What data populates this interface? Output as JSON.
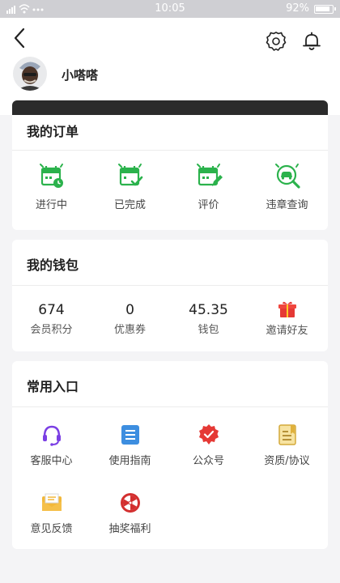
{
  "status_bar": {
    "time": "10:05",
    "battery": "92%",
    "signal_icon": "wifi-signal-icon"
  },
  "header": {
    "username": "小嗒嗒",
    "icons": [
      "back-arrow-icon",
      "gear-icon",
      "bell-icon"
    ]
  },
  "colors": {
    "accent": "#2bb24c",
    "card_bg": "#ffffff",
    "page_bg": "#f4f4f6",
    "dark_bar": "#2b2b2b"
  },
  "orders": {
    "title": "我的订单",
    "items": [
      {
        "label": "进行中",
        "icon": "calendar-clock-icon"
      },
      {
        "label": "已完成",
        "icon": "calendar-check-icon"
      },
      {
        "label": "评价",
        "icon": "calendar-edit-icon"
      },
      {
        "label": "违章查询",
        "icon": "car-search-icon"
      }
    ]
  },
  "wallet": {
    "title": "我的钱包",
    "items": [
      {
        "value": "674",
        "label": "会员积分"
      },
      {
        "value": "0",
        "label": "优惠券"
      },
      {
        "value": "45.35",
        "label": "钱包"
      },
      {
        "value": "",
        "label": "邀请好友",
        "icon": "gift-icon"
      }
    ]
  },
  "shortcuts": {
    "title": "常用入口",
    "items": [
      {
        "label": "客服中心",
        "icon": "headset-icon"
      },
      {
        "label": "使用指南",
        "icon": "guide-list-icon"
      },
      {
        "label": "公众号",
        "icon": "badge-check-icon"
      },
      {
        "label": "资质/协议",
        "icon": "document-bookmark-icon"
      },
      {
        "label": "意见反馈",
        "icon": "mail-icon"
      },
      {
        "label": "抽奖福利",
        "icon": "prize-wheel-icon"
      }
    ]
  }
}
